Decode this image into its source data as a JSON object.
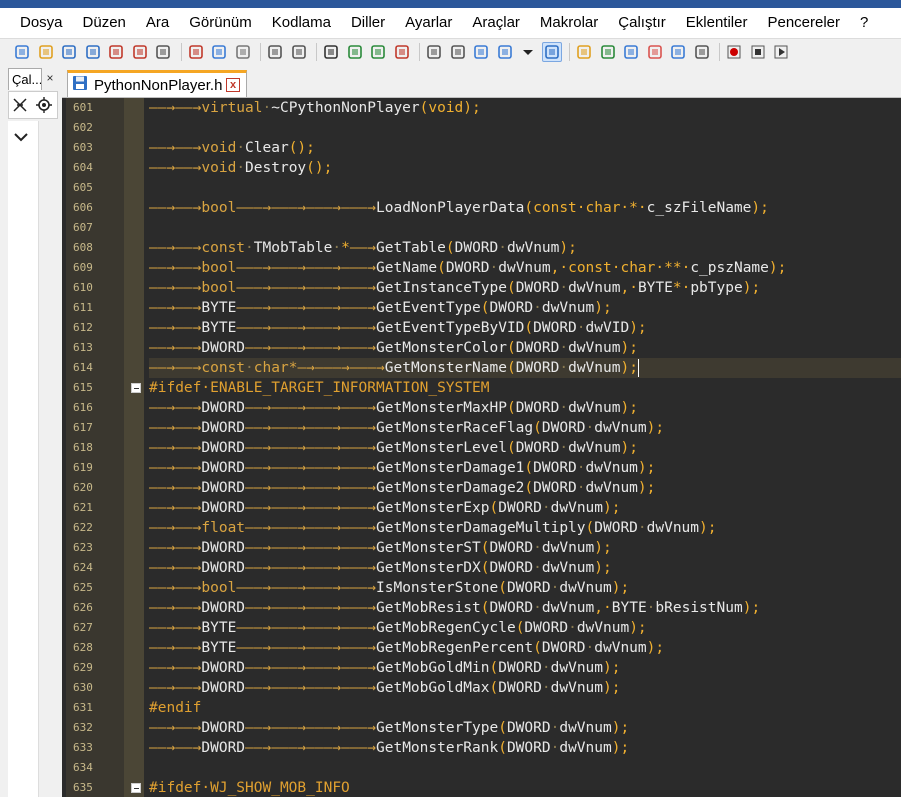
{
  "menu": [
    "Dosya",
    "Düzen",
    "Ara",
    "Görünüm",
    "Kodlama",
    "Diller",
    "Ayarlar",
    "Araçlar",
    "Makrolar",
    "Çalıştır",
    "Eklentiler",
    "Pencereler",
    "?"
  ],
  "toolbar_icons": [
    "new-file-icon",
    "open-file-icon",
    "save-icon",
    "save-all-icon",
    "close-icon",
    "close-all-icon",
    "print-icon",
    "cut-icon",
    "copy-icon",
    "paste-icon",
    "undo-icon",
    "redo-icon",
    "find-icon",
    "replace-icon",
    "zoom-in-icon",
    "zoom-out-icon",
    "sync-vertical-icon",
    "sync-horizontal-icon",
    "word-wrap-icon",
    "show-all-chars-icon",
    "dropdown-icon",
    "indent-guide-icon",
    "user-lang-icon",
    "doc-map-icon",
    "function-list-icon",
    "folder-workspace-icon",
    "monitoring-icon",
    "view-icon",
    "record-macro-icon",
    "stop-macro-icon",
    "play-macro-icon"
  ],
  "left_panel": {
    "tab_label": "Çal...",
    "close": "×"
  },
  "tab": {
    "label": "PythonNonPlayer.h",
    "close": "x"
  },
  "lines": [
    {
      "n": "601",
      "indent": 2,
      "parts": [
        [
          "k",
          "virtual"
        ],
        [
          "ws",
          "·"
        ],
        [
          "t",
          "~CPythonNonPlayer"
        ],
        [
          "fn",
          "(void);"
        ]
      ]
    },
    {
      "n": "602",
      "indent": 0,
      "parts": []
    },
    {
      "n": "603",
      "indent": 2,
      "parts": [
        [
          "k",
          "void"
        ],
        [
          "ws",
          "·"
        ],
        [
          "t",
          "Clear"
        ],
        [
          "fn",
          "();"
        ]
      ]
    },
    {
      "n": "604",
      "indent": 2,
      "parts": [
        [
          "k",
          "void"
        ],
        [
          "ws",
          "·"
        ],
        [
          "t",
          "Destroy"
        ],
        [
          "fn",
          "();"
        ]
      ]
    },
    {
      "n": "605",
      "indent": 0,
      "parts": []
    },
    {
      "n": "606",
      "indent": 2,
      "parts": [
        [
          "k",
          "bool"
        ],
        [
          "arw",
          "———→———→———→———→"
        ],
        [
          "t",
          "LoadNonPlayerData"
        ],
        [
          "fn",
          "(const·char·*·"
        ],
        [
          "t",
          "c_szFileName"
        ],
        [
          "fn",
          ");"
        ]
      ]
    },
    {
      "n": "607",
      "indent": 0,
      "parts": []
    },
    {
      "n": "608",
      "indent": 2,
      "parts": [
        [
          "k",
          "const"
        ],
        [
          "ws",
          "·"
        ],
        [
          "t",
          "TMobTable"
        ],
        [
          "ws",
          "·"
        ],
        [
          "fn",
          "*"
        ],
        [
          "arw",
          "——→"
        ],
        [
          "t",
          "GetTable"
        ],
        [
          "fn",
          "("
        ],
        [
          "t",
          "DWORD"
        ],
        [
          "ws",
          "·"
        ],
        [
          "t",
          "dwVnum"
        ],
        [
          "fn",
          ");"
        ]
      ]
    },
    {
      "n": "609",
      "indent": 2,
      "parts": [
        [
          "k",
          "bool"
        ],
        [
          "arw",
          "———→———→———→———→"
        ],
        [
          "t",
          "GetName"
        ],
        [
          "fn",
          "("
        ],
        [
          "t",
          "DWORD"
        ],
        [
          "ws",
          "·"
        ],
        [
          "t",
          "dwVnum"
        ],
        [
          "fn",
          ",·const·char·**·"
        ],
        [
          "t",
          "c_pszName"
        ],
        [
          "fn",
          ");"
        ]
      ]
    },
    {
      "n": "610",
      "indent": 2,
      "parts": [
        [
          "k",
          "bool"
        ],
        [
          "arw",
          "———→———→———→———→"
        ],
        [
          "t",
          "GetInstanceType"
        ],
        [
          "fn",
          "("
        ],
        [
          "t",
          "DWORD"
        ],
        [
          "ws",
          "·"
        ],
        [
          "t",
          "dwVnum"
        ],
        [
          "fn",
          ",·"
        ],
        [
          "t",
          "BYTE"
        ],
        [
          "fn",
          "*·"
        ],
        [
          "t",
          "pbType"
        ],
        [
          "fn",
          ");"
        ]
      ]
    },
    {
      "n": "611",
      "indent": 2,
      "parts": [
        [
          "t",
          "BYTE"
        ],
        [
          "arw",
          "———→———→———→———→"
        ],
        [
          "t",
          "GetEventType"
        ],
        [
          "fn",
          "("
        ],
        [
          "t",
          "DWORD"
        ],
        [
          "ws",
          "·"
        ],
        [
          "t",
          "dwVnum"
        ],
        [
          "fn",
          ");"
        ]
      ]
    },
    {
      "n": "612",
      "indent": 2,
      "parts": [
        [
          "t",
          "BYTE"
        ],
        [
          "arw",
          "———→———→———→———→"
        ],
        [
          "t",
          "GetEventTypeByVID"
        ],
        [
          "fn",
          "("
        ],
        [
          "t",
          "DWORD"
        ],
        [
          "ws",
          "·"
        ],
        [
          "t",
          "dwVID"
        ],
        [
          "fn",
          ");"
        ]
      ]
    },
    {
      "n": "613",
      "indent": 2,
      "parts": [
        [
          "t",
          "DWORD"
        ],
        [
          "arw",
          "——→———→———→———→"
        ],
        [
          "t",
          "GetMonsterColor"
        ],
        [
          "fn",
          "("
        ],
        [
          "t",
          "DWORD"
        ],
        [
          "ws",
          "·"
        ],
        [
          "t",
          "dwVnum"
        ],
        [
          "fn",
          ");"
        ]
      ]
    },
    {
      "n": "614",
      "indent": 2,
      "active": true,
      "parts": [
        [
          "k",
          "const"
        ],
        [
          "ws",
          "·"
        ],
        [
          "k",
          "char*"
        ],
        [
          "arw",
          "—→———→———→"
        ],
        [
          "t",
          "GetMonsterName"
        ],
        [
          "fn",
          "("
        ],
        [
          "t",
          "DWORD"
        ],
        [
          "ws",
          "·"
        ],
        [
          "t",
          "dwVnum"
        ],
        [
          "fn",
          ");"
        ]
      ]
    },
    {
      "n": "615",
      "indent": 0,
      "fold": true,
      "parts": [
        [
          "pp",
          "#ifdef·ENABLE_TARGET_INFORMATION_SYSTEM"
        ]
      ]
    },
    {
      "n": "616",
      "indent": 2,
      "parts": [
        [
          "t",
          "DWORD"
        ],
        [
          "arw",
          "——→———→———→———→"
        ],
        [
          "t",
          "GetMonsterMaxHP"
        ],
        [
          "fn",
          "("
        ],
        [
          "t",
          "DWORD"
        ],
        [
          "ws",
          "·"
        ],
        [
          "t",
          "dwVnum"
        ],
        [
          "fn",
          ");"
        ]
      ]
    },
    {
      "n": "617",
      "indent": 2,
      "parts": [
        [
          "t",
          "DWORD"
        ],
        [
          "arw",
          "——→———→———→———→"
        ],
        [
          "t",
          "GetMonsterRaceFlag"
        ],
        [
          "fn",
          "("
        ],
        [
          "t",
          "DWORD"
        ],
        [
          "ws",
          "·"
        ],
        [
          "t",
          "dwVnum"
        ],
        [
          "fn",
          ");"
        ]
      ]
    },
    {
      "n": "618",
      "indent": 2,
      "parts": [
        [
          "t",
          "DWORD"
        ],
        [
          "arw",
          "——→———→———→———→"
        ],
        [
          "t",
          "GetMonsterLevel"
        ],
        [
          "fn",
          "("
        ],
        [
          "t",
          "DWORD"
        ],
        [
          "ws",
          "·"
        ],
        [
          "t",
          "dwVnum"
        ],
        [
          "fn",
          ");"
        ]
      ]
    },
    {
      "n": "619",
      "indent": 2,
      "parts": [
        [
          "t",
          "DWORD"
        ],
        [
          "arw",
          "——→———→———→———→"
        ],
        [
          "t",
          "GetMonsterDamage1"
        ],
        [
          "fn",
          "("
        ],
        [
          "t",
          "DWORD"
        ],
        [
          "ws",
          "·"
        ],
        [
          "t",
          "dwVnum"
        ],
        [
          "fn",
          ");"
        ]
      ]
    },
    {
      "n": "620",
      "indent": 2,
      "parts": [
        [
          "t",
          "DWORD"
        ],
        [
          "arw",
          "——→———→———→———→"
        ],
        [
          "t",
          "GetMonsterDamage2"
        ],
        [
          "fn",
          "("
        ],
        [
          "t",
          "DWORD"
        ],
        [
          "ws",
          "·"
        ],
        [
          "t",
          "dwVnum"
        ],
        [
          "fn",
          ");"
        ]
      ]
    },
    {
      "n": "621",
      "indent": 2,
      "parts": [
        [
          "t",
          "DWORD"
        ],
        [
          "arw",
          "——→———→———→———→"
        ],
        [
          "t",
          "GetMonsterExp"
        ],
        [
          "fn",
          "("
        ],
        [
          "t",
          "DWORD"
        ],
        [
          "ws",
          "·"
        ],
        [
          "t",
          "dwVnum"
        ],
        [
          "fn",
          ");"
        ]
      ]
    },
    {
      "n": "622",
      "indent": 2,
      "parts": [
        [
          "k",
          "float"
        ],
        [
          "arw",
          "——→———→———→———→"
        ],
        [
          "t",
          "GetMonsterDamageMultiply"
        ],
        [
          "fn",
          "("
        ],
        [
          "t",
          "DWORD"
        ],
        [
          "ws",
          "·"
        ],
        [
          "t",
          "dwVnum"
        ],
        [
          "fn",
          ");"
        ]
      ]
    },
    {
      "n": "623",
      "indent": 2,
      "parts": [
        [
          "t",
          "DWORD"
        ],
        [
          "arw",
          "——→———→———→———→"
        ],
        [
          "t",
          "GetMonsterST"
        ],
        [
          "fn",
          "("
        ],
        [
          "t",
          "DWORD"
        ],
        [
          "ws",
          "·"
        ],
        [
          "t",
          "dwVnum"
        ],
        [
          "fn",
          ");"
        ]
      ]
    },
    {
      "n": "624",
      "indent": 2,
      "parts": [
        [
          "t",
          "DWORD"
        ],
        [
          "arw",
          "——→———→———→———→"
        ],
        [
          "t",
          "GetMonsterDX"
        ],
        [
          "fn",
          "("
        ],
        [
          "t",
          "DWORD"
        ],
        [
          "ws",
          "·"
        ],
        [
          "t",
          "dwVnum"
        ],
        [
          "fn",
          ");"
        ]
      ]
    },
    {
      "n": "625",
      "indent": 2,
      "parts": [
        [
          "k",
          "bool"
        ],
        [
          "arw",
          "———→———→———→———→"
        ],
        [
          "t",
          "IsMonsterStone"
        ],
        [
          "fn",
          "("
        ],
        [
          "t",
          "DWORD"
        ],
        [
          "ws",
          "·"
        ],
        [
          "t",
          "dwVnum"
        ],
        [
          "fn",
          ");"
        ]
      ]
    },
    {
      "n": "626",
      "indent": 2,
      "parts": [
        [
          "t",
          "DWORD"
        ],
        [
          "arw",
          "——→———→———→———→"
        ],
        [
          "t",
          "GetMobResist"
        ],
        [
          "fn",
          "("
        ],
        [
          "t",
          "DWORD"
        ],
        [
          "ws",
          "·"
        ],
        [
          "t",
          "dwVnum"
        ],
        [
          "fn",
          ",·"
        ],
        [
          "t",
          "BYTE"
        ],
        [
          "ws",
          "·"
        ],
        [
          "t",
          "bResistNum"
        ],
        [
          "fn",
          ");"
        ]
      ]
    },
    {
      "n": "627",
      "indent": 2,
      "parts": [
        [
          "t",
          "BYTE"
        ],
        [
          "arw",
          "———→———→———→———→"
        ],
        [
          "t",
          "GetMobRegenCycle"
        ],
        [
          "fn",
          "("
        ],
        [
          "t",
          "DWORD"
        ],
        [
          "ws",
          "·"
        ],
        [
          "t",
          "dwVnum"
        ],
        [
          "fn",
          ");"
        ]
      ]
    },
    {
      "n": "628",
      "indent": 2,
      "parts": [
        [
          "t",
          "BYTE"
        ],
        [
          "arw",
          "———→———→———→———→"
        ],
        [
          "t",
          "GetMobRegenPercent"
        ],
        [
          "fn",
          "("
        ],
        [
          "t",
          "DWORD"
        ],
        [
          "ws",
          "·"
        ],
        [
          "t",
          "dwVnum"
        ],
        [
          "fn",
          ");"
        ]
      ]
    },
    {
      "n": "629",
      "indent": 2,
      "parts": [
        [
          "t",
          "DWORD"
        ],
        [
          "arw",
          "——→———→———→———→"
        ],
        [
          "t",
          "GetMobGoldMin"
        ],
        [
          "fn",
          "("
        ],
        [
          "t",
          "DWORD"
        ],
        [
          "ws",
          "·"
        ],
        [
          "t",
          "dwVnum"
        ],
        [
          "fn",
          ");"
        ]
      ]
    },
    {
      "n": "630",
      "indent": 2,
      "parts": [
        [
          "t",
          "DWORD"
        ],
        [
          "arw",
          "——→———→———→———→"
        ],
        [
          "t",
          "GetMobGoldMax"
        ],
        [
          "fn",
          "("
        ],
        [
          "t",
          "DWORD"
        ],
        [
          "ws",
          "·"
        ],
        [
          "t",
          "dwVnum"
        ],
        [
          "fn",
          ");"
        ]
      ]
    },
    {
      "n": "631",
      "indent": 0,
      "parts": [
        [
          "pp",
          "#endif"
        ]
      ]
    },
    {
      "n": "632",
      "indent": 2,
      "parts": [
        [
          "t",
          "DWORD"
        ],
        [
          "arw",
          "——→———→———→———→"
        ],
        [
          "t",
          "GetMonsterType"
        ],
        [
          "fn",
          "("
        ],
        [
          "t",
          "DWORD"
        ],
        [
          "ws",
          "·"
        ],
        [
          "t",
          "dwVnum"
        ],
        [
          "fn",
          ");"
        ]
      ]
    },
    {
      "n": "633",
      "indent": 2,
      "parts": [
        [
          "t",
          "DWORD"
        ],
        [
          "arw",
          "——→———→———→———→"
        ],
        [
          "t",
          "GetMonsterRank"
        ],
        [
          "fn",
          "("
        ],
        [
          "t",
          "DWORD"
        ],
        [
          "ws",
          "·"
        ],
        [
          "t",
          "dwVnum"
        ],
        [
          "fn",
          ");"
        ]
      ]
    },
    {
      "n": "634",
      "indent": 0,
      "parts": []
    },
    {
      "n": "635",
      "indent": 0,
      "fold": true,
      "parts": [
        [
          "pp",
          "#ifdef·WJ_SHOW_MOB_INFO"
        ]
      ]
    }
  ]
}
